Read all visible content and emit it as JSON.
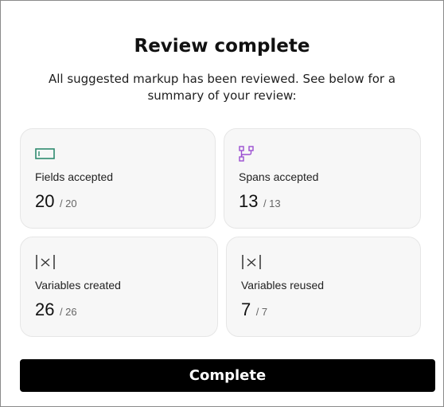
{
  "dialog": {
    "title": "Review complete",
    "subtitle": "All suggested markup has been reviewed. See below for a summary of your review:"
  },
  "cards": [
    {
      "label": "Fields accepted",
      "count": "20",
      "total": "/ 20",
      "icon": "field-icon",
      "icon_color": "#2e8b6e"
    },
    {
      "label": "Spans accepted",
      "count": "13",
      "total": "/ 13",
      "icon": "branch-icon",
      "icon_color": "#9b4fd1"
    },
    {
      "label": "Variables created",
      "count": "26",
      "total": "/ 26",
      "icon": "variable-icon",
      "icon_color": "#333333"
    },
    {
      "label": "Variables reused",
      "count": "7",
      "total": "/ 7",
      "icon": "variable-icon",
      "icon_color": "#333333"
    }
  ],
  "actions": {
    "complete_label": "Complete"
  }
}
